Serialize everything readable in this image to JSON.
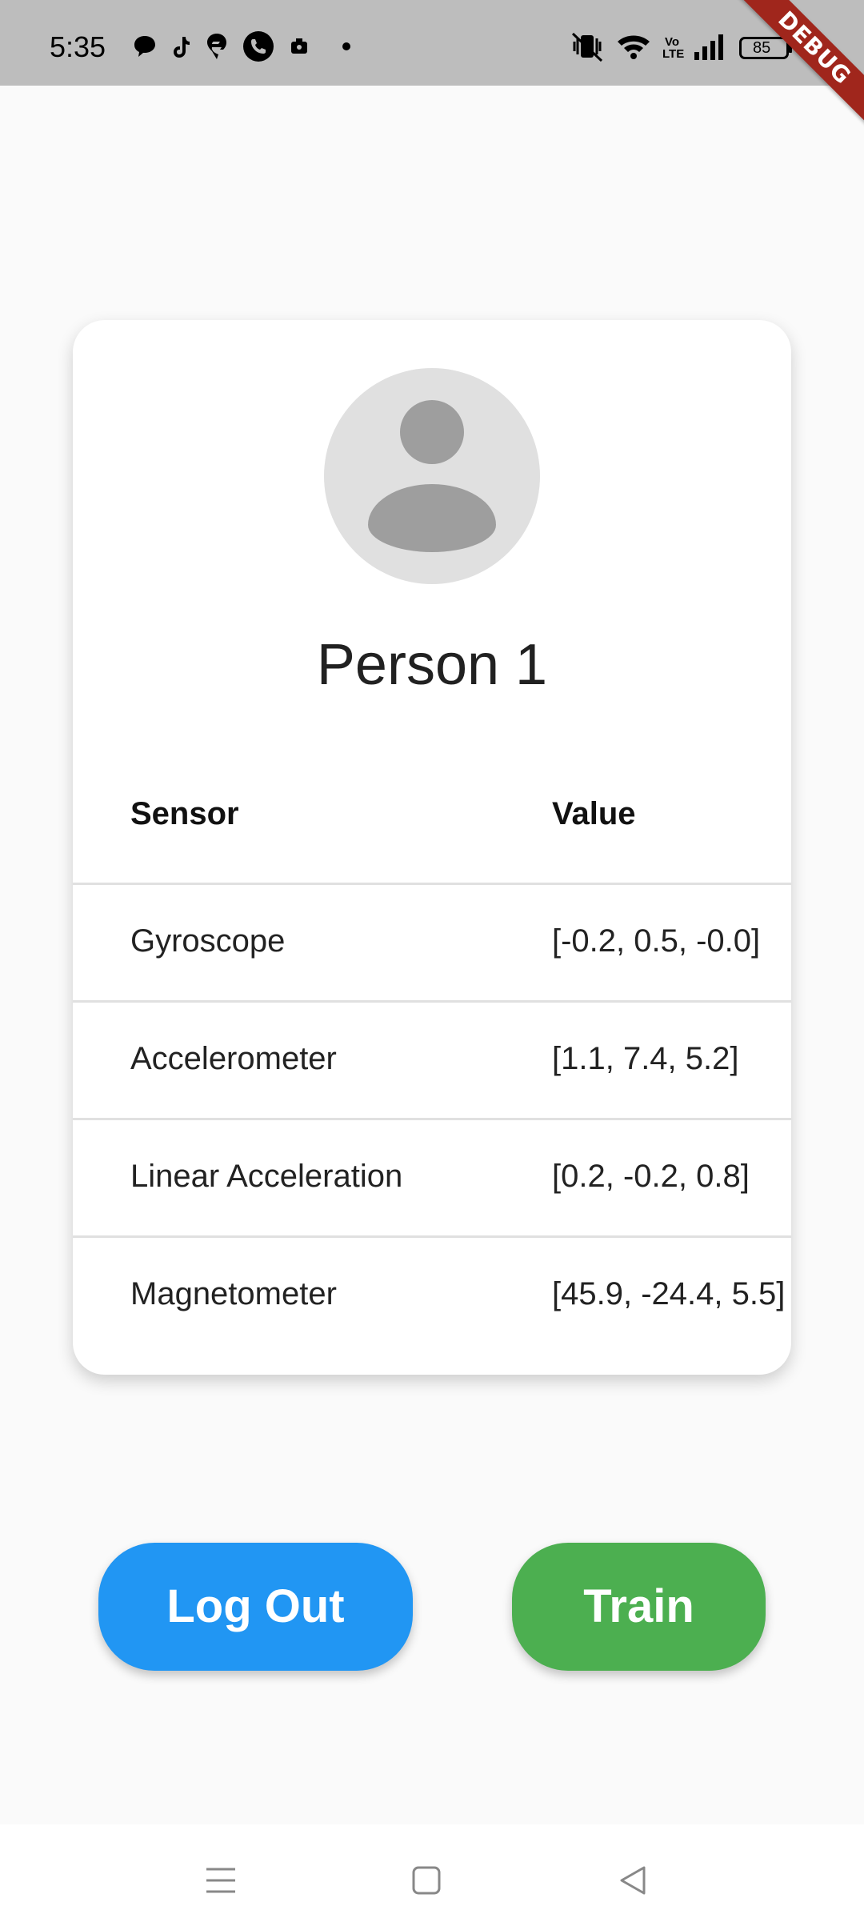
{
  "status_bar": {
    "time": "5:35",
    "battery": "85",
    "notification_icons": [
      "chat-bubble-icon",
      "tiktok-icon",
      "swiggy-icon",
      "phone-icon",
      "camera-icon",
      "dot-icon"
    ],
    "system_icons": [
      "vibrate-off-icon",
      "wifi-icon",
      "volte-icon",
      "signal-icon",
      "battery-icon"
    ],
    "volte_label": "Vo LTE"
  },
  "debug_banner": {
    "label": "DEBUG",
    "color": "#a0261c"
  },
  "profile": {
    "name": "Person 1",
    "avatar_icon": "person-avatar-icon"
  },
  "sensor_table": {
    "headers": {
      "sensor": "Sensor",
      "value": "Value"
    },
    "rows": [
      {
        "sensor": "Gyroscope",
        "value": "[-0.2, 0.5, -0.0]"
      },
      {
        "sensor": "Accelerometer",
        "value": "[1.1, 7.4, 5.2]"
      },
      {
        "sensor": "Linear Acceleration",
        "value": "[0.2, -0.2, 0.8]"
      },
      {
        "sensor": "Magnetometer",
        "value": "[45.9, -24.4, 5.5]"
      }
    ]
  },
  "buttons": {
    "logout_label": "Log Out",
    "logout_color": "#2196f3",
    "train_label": "Train",
    "train_color": "#4caf50"
  },
  "nav_bar": {
    "items": [
      "menu-icon",
      "home-icon",
      "back-icon"
    ]
  }
}
